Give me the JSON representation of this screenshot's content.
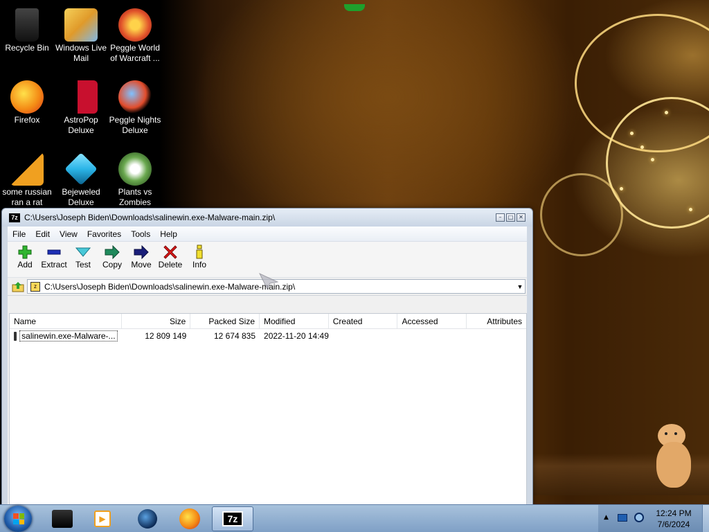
{
  "desktop": {
    "icons": [
      {
        "label": "Recycle Bin",
        "icon": "recycle-bin-icon",
        "color": "#1d1d1d"
      },
      {
        "label": "Windows Live Mail",
        "icon": "mail-icon",
        "color": "#f1b53a"
      },
      {
        "label": "Peggle World of Warcraft ...",
        "icon": "peggle-wow-icon",
        "color": "#d9472b"
      },
      {
        "label": "Firefox",
        "icon": "firefox-icon",
        "color": "#f48b15"
      },
      {
        "label": "AstroPop Deluxe",
        "icon": "astropop-icon",
        "color": "#c8102e"
      },
      {
        "label": "Peggle Nights Deluxe",
        "icon": "peggle-nights-icon",
        "color": "#e24c2b"
      },
      {
        "label": "some russian ran a rat",
        "icon": "file-icon",
        "color": "#f0a020"
      },
      {
        "label": "Bejeweled Deluxe",
        "icon": "bejeweled-icon",
        "color": "#2bb5e8"
      },
      {
        "label": "Plants vs Zombies",
        "icon": "plants-vs-zombies-icon",
        "color": "#6aa84f"
      }
    ]
  },
  "window": {
    "title": "C:\\Users\\Joseph Biden\\Downloads\\salinewin.exe-Malware-main.zip\\",
    "logo": "7z",
    "menu": [
      "File",
      "Edit",
      "View",
      "Favorites",
      "Tools",
      "Help"
    ],
    "toolbar": [
      {
        "label": "Add",
        "icon": "add-icon"
      },
      {
        "label": "Extract",
        "icon": "extract-icon"
      },
      {
        "label": "Test",
        "icon": "test-icon"
      },
      {
        "label": "Copy",
        "icon": "copy-icon"
      },
      {
        "label": "Move",
        "icon": "move-icon"
      },
      {
        "label": "Delete",
        "icon": "delete-icon"
      },
      {
        "label": "Info",
        "icon": "info-icon"
      }
    ],
    "address": "C:\\Users\\Joseph Biden\\Downloads\\salinewin.exe-Malware-main.zip\\",
    "columns": [
      "Name",
      "Size",
      "Packed Size",
      "Modified",
      "Created",
      "Accessed",
      "Attributes"
    ],
    "rows": [
      {
        "name": "salinewin.exe-Malware-...",
        "size": "12 809 149",
        "packed": "12 674 835",
        "modified": "2022-11-20 14:49",
        "created": "",
        "accessed": "",
        "attributes": ""
      }
    ]
  },
  "taskbar": {
    "items": [
      "folder-icon",
      "media-player-icon",
      "globe-icon",
      "firefox-icon",
      "7zip-icon"
    ],
    "active_label": "7z",
    "time": "12:24 PM",
    "date": "7/6/2024"
  }
}
